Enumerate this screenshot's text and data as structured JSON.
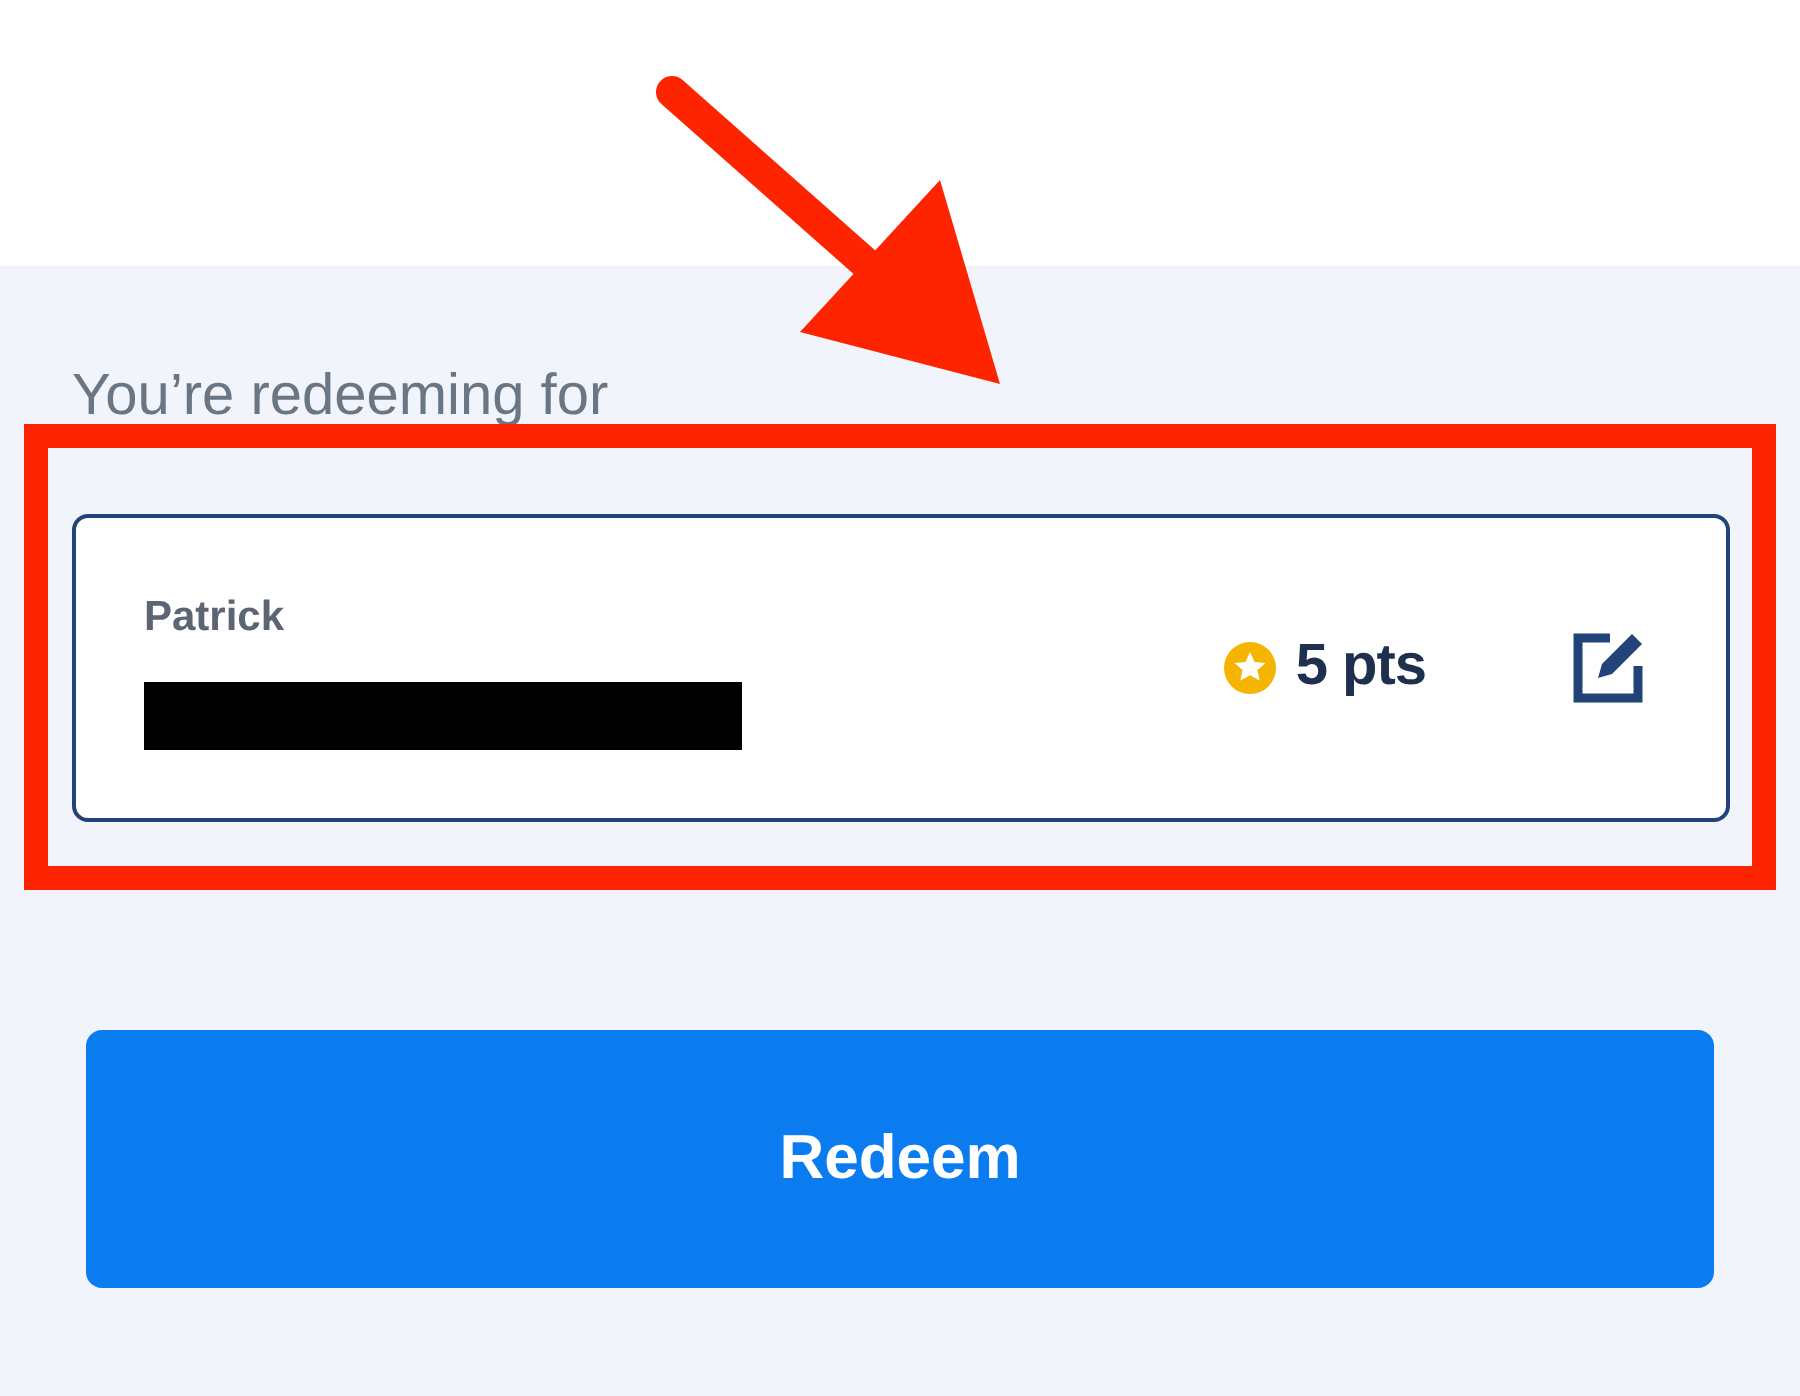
{
  "prompt": "You’re redeeming for",
  "recipient": {
    "name": "Patrick",
    "points": "5 pts"
  },
  "button": "Redeem"
}
